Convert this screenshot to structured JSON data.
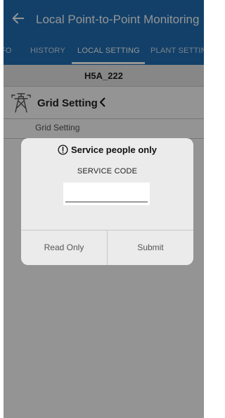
{
  "app": {
    "title": "Local Point-to-Point Monitoring",
    "back_icon": "arrow-left-icon"
  },
  "tabs": [
    {
      "label": "FO"
    },
    {
      "label": "HISTORY"
    },
    {
      "label": "LOCAL SETTING",
      "active": true
    },
    {
      "label": "PLANT SETTING"
    }
  ],
  "device": {
    "name": "H5A_222"
  },
  "grid_section": {
    "title": "Grid Setting",
    "sub_item": "Grid Setting",
    "icon": "transmission-tower-icon",
    "chevron": "chevron-left-icon"
  },
  "dialog": {
    "title": "Service people only",
    "icon": "info-circle-icon",
    "code_label": "SERVICE CODE",
    "code_value": "",
    "buttons": {
      "read_only": "Read Only",
      "submit": "Submit"
    }
  },
  "colors": {
    "appbar": "#1f6fb5",
    "dialog_bg": "#ebebeb",
    "overlay": "rgba(0,0,0,0.42)"
  }
}
